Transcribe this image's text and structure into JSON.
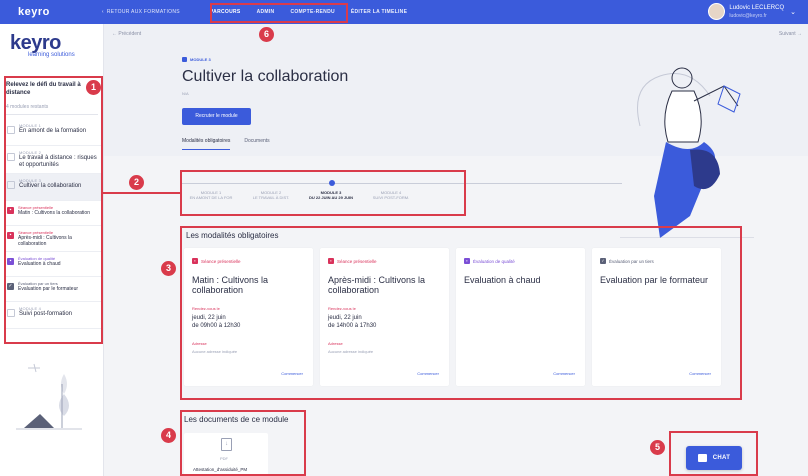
{
  "topbar": {
    "logo": "keyro",
    "back_label": "RETOUR AUX FORMATIONS",
    "nav": [
      "PARCOURS",
      "ADMIN",
      "COMPTE-RENDU",
      "ÉDITER LA TIMELINE"
    ],
    "user_name": "Ludovic LECLERCQ",
    "user_email": "ludovic@keyro.fr"
  },
  "sidebar": {
    "brand_name": "keyro",
    "brand_sub": "learning solutions",
    "course_title": "Relevez le défi du travail à distance",
    "course_sub": "4 modules restants",
    "modules": [
      {
        "meta": "MODULE 1",
        "name": "En amont de la formation"
      },
      {
        "meta": "MODULE 2",
        "name": "Le travail à distance : risques et opportunités"
      },
      {
        "meta": "MODULE 3",
        "name": "Cultiver la collaboration"
      }
    ],
    "subitems": [
      {
        "meta": "Séance présentielle",
        "name": "Matin : Cultivons la collaboration",
        "color": "#d9325b"
      },
      {
        "meta": "Séance présentielle",
        "name": "Après-midi : Cultivons la collaboration",
        "color": "#d9325b"
      },
      {
        "meta": "Évaluation de qualité",
        "name": "Evaluation à chaud",
        "color": "#7b4fd6"
      },
      {
        "meta": "Évaluation par un tiers",
        "name": "Evaluation par le formateur",
        "color": "#5b6178"
      }
    ],
    "last_module": {
      "meta": "MODULE 4",
      "name": "Suivi post-formation"
    }
  },
  "main": {
    "prev_label": "← Précédent",
    "next_label": "Suivant →",
    "module_label": "MODULE 3",
    "title": "Cultiver la collaboration",
    "nslash": "N/A",
    "cta_label": "Recruter le module",
    "tabs": [
      "Modalités obligatoires",
      "Documents"
    ],
    "stepper": [
      {
        "label": "MODULE 1",
        "sub": "EN AMONT DE LA FOR"
      },
      {
        "label": "MODULE 2",
        "sub": "LE TRAVAIL À DIST."
      },
      {
        "label": "MODULE 3",
        "sub": "DU 22 JUIN AU 29 JUIN"
      },
      {
        "label": "MODULE 4",
        "sub": "SUIVI POST-FORM."
      }
    ],
    "modalities_title": "Les modalités obligatoires",
    "cards": [
      {
        "type": "Séance présentielle",
        "title": "Matin : Cultivons la collaboration",
        "rlabel": "Rendez-vous le",
        "rdate": "jeudi, 22 juin",
        "rtime": "de 09h00 à 12h30",
        "alabel": "Adresse",
        "aval": "Aucune adresse indiquée",
        "start": "Commencer",
        "color": "#d9325b"
      },
      {
        "type": "Séance présentielle",
        "title": "Après-midi : Cultivons la collaboration",
        "rlabel": "Rendez-vous le",
        "rdate": "jeudi, 22 juin",
        "rtime": "de 14h00 à 17h30",
        "alabel": "Adresse",
        "aval": "Aucune adresse indiquée",
        "start": "Commencer",
        "color": "#d9325b"
      },
      {
        "type": "Évaluation de qualité",
        "title": "Evaluation à chaud",
        "start": "Commencer",
        "color": "#7b4fd6"
      },
      {
        "type": "Évaluation par un tiers",
        "title": "Evaluation par le formateur",
        "start": "Commencer",
        "color": "#5b6178"
      }
    ],
    "documents_title": "Les documents de ce module",
    "doc": {
      "type": "PDF",
      "name": "Attestation_d'assiduité_PM"
    },
    "chat_label": "CHAT"
  },
  "annotations": [
    "1",
    "2",
    "3",
    "4",
    "5",
    "6"
  ]
}
